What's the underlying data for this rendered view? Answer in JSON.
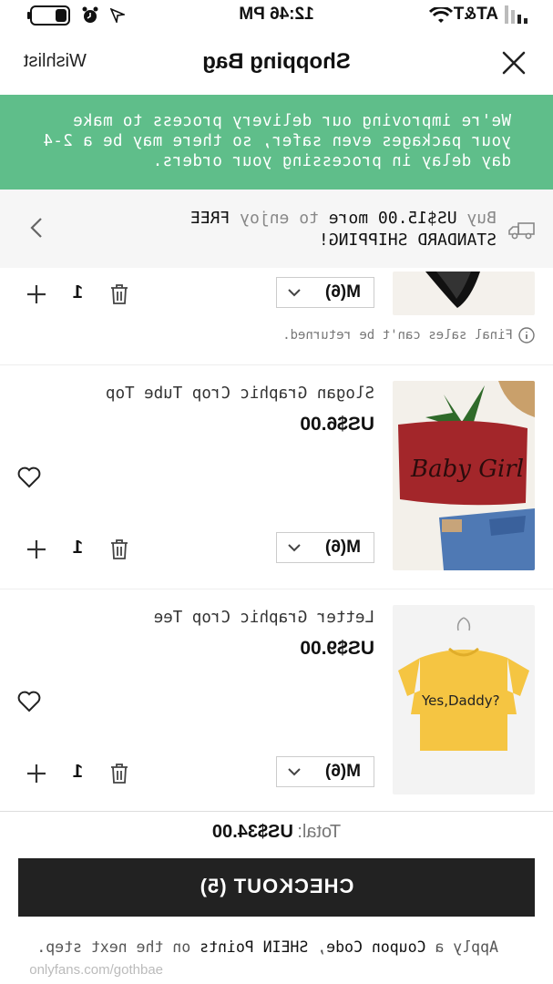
{
  "status_bar": {
    "time": "12:46 PM",
    "carrier": "AT&T"
  },
  "header": {
    "title": "Shopping Bag",
    "wishlist_label": "Wishlist",
    "close_icon": "close-icon"
  },
  "banner": {
    "message": "We're improving our delivery process to make your packages even safer, so there may be a 2-4 day delay in processing your orders."
  },
  "shipping": {
    "prefix": "Buy ",
    "amount": "US$15.00 more",
    "middle": " to enjoy ",
    "emphasis": "FREE STANDARD SHIPPING!"
  },
  "items": [
    {
      "size": "M(6)",
      "quantity": "1",
      "note": "Final sales can't be returned."
    },
    {
      "name": "Slogan Graphic Crop Tube Top",
      "price": "US$6.00",
      "size": "M(6)",
      "quantity": "1",
      "print_text": "Baby Girl"
    },
    {
      "name": "Letter Graphic Crop Tee",
      "price": "US$9.00",
      "size": "M(6)",
      "quantity": "1",
      "print_text": "Yes,Daddy?"
    }
  ],
  "summary": {
    "total_label": "Total:",
    "total_value": "US$34.00",
    "checkout_label": "CHECKOUT (5)"
  },
  "coupon": {
    "prefix": "Apply a ",
    "code_label": "Coupon Code",
    "sep": ", ",
    "points_label": "SHEIN Points",
    "suffix": " on the next step."
  },
  "watermark": "onlyfans.com/gothbae",
  "colors": {
    "banner": "#5fbe8a",
    "checkout": "#222222"
  }
}
